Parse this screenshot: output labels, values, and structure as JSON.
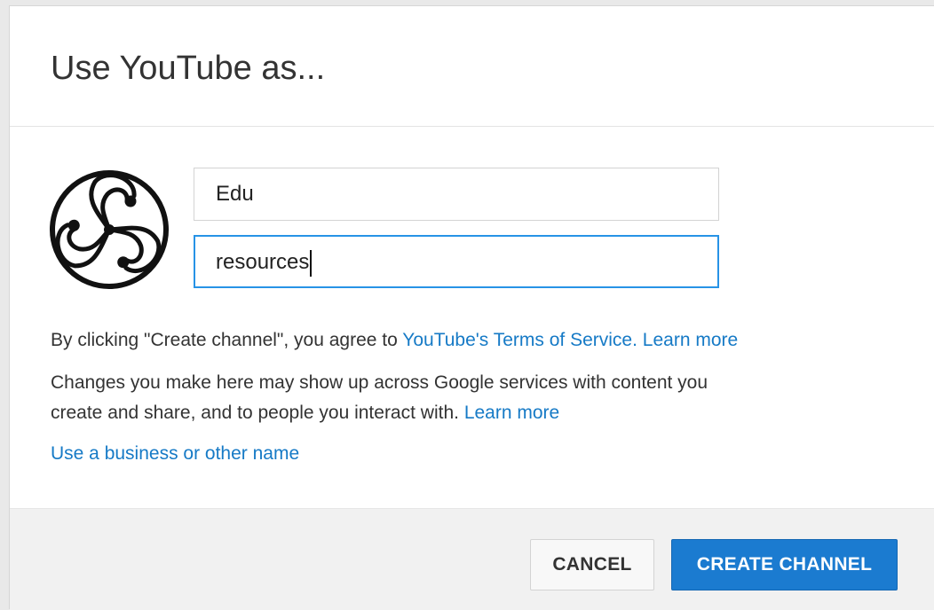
{
  "dialog": {
    "title": "Use YouTube as..."
  },
  "avatar": {
    "icon": "triskelion-logo"
  },
  "form": {
    "first_name_value": "Edu",
    "last_name_value": "resources"
  },
  "legal": {
    "terms_prefix": "By clicking \"Create channel\", you agree to ",
    "terms_link": "YouTube's Terms of Service.",
    "terms_learn_more": "Learn more",
    "changes_line1": "Changes you make here may show up across Google services with content you",
    "changes_line2": "create and share, and to people you interact with.",
    "changes_learn_more": "Learn more"
  },
  "alt_name_link": "Use a business or other name",
  "footer": {
    "cancel_label": "CANCEL",
    "create_label": "CREATE CHANNEL"
  },
  "colors": {
    "link": "#167ac6",
    "primary_button": "#1b7bd0",
    "focus_border": "#2793e6"
  }
}
